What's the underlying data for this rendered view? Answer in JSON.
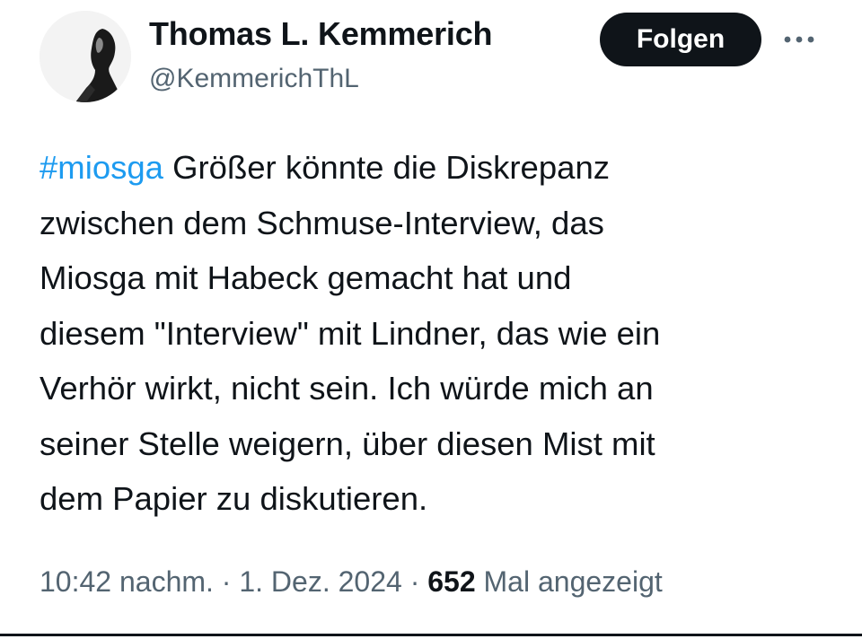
{
  "author": {
    "display_name": "Thomas L. Kemmerich",
    "handle": "@KemmerichThL",
    "avatar_icon": "profile-photo"
  },
  "actions": {
    "follow_label": "Folgen",
    "more_icon": "more-horizontal-icon"
  },
  "tweet": {
    "hashtag": "#miosga",
    "lines": [
      " Größer könnte die Diskrepanz",
      "zwischen dem Schmuse-Interview, das",
      "Miosga mit Habeck gemacht hat und",
      "diesem \"Interview\" mit Lindner, das wie ein",
      "Verhör wirkt, nicht sein. Ich würde mich an",
      "seiner Stelle weigern, über diesen Mist mit",
      "dem Papier zu diskutieren."
    ]
  },
  "meta": {
    "time": "10:42 nachm.",
    "separator": " · ",
    "date": "1. Dez. 2024",
    "views_count": "652",
    "views_label": " Mal angezeigt"
  },
  "colors": {
    "text": "#0f1419",
    "secondary": "#536471",
    "link": "#1d9bf0",
    "button_bg": "#0f1419",
    "button_text": "#ffffff"
  }
}
